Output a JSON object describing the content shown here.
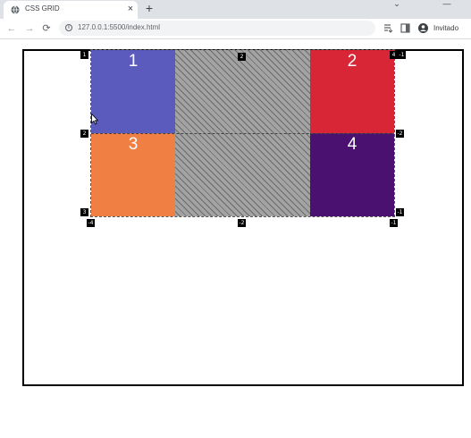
{
  "tab": {
    "title": "CSS GRID",
    "favicon": "globe-icon",
    "close_glyph": "×"
  },
  "tabstrip": {
    "new_tab_glyph": "+",
    "minimize_glyph": "—",
    "chevron_glyph": "⌄"
  },
  "toolbar": {
    "back_glyph": "←",
    "forward_glyph": "→",
    "reload_glyph": "⟳",
    "url": "127.0.0.1:5500/index.html",
    "info_glyph": "i",
    "profile_label": "Invitado"
  },
  "grid": {
    "items": [
      {
        "label": "1",
        "color": "#5b5bbe"
      },
      {
        "label": "2",
        "color": "#d92637"
      },
      {
        "label": "3",
        "color": "#f07f44"
      },
      {
        "label": "4",
        "color": "#4a1170"
      }
    ],
    "gap_fill_color": "#a3a3a3",
    "line_numbers": {
      "top_col_1": "1",
      "top_col_2": "2",
      "top_col_4": "4",
      "top_col_neg1": "-1",
      "left_row_2": "2",
      "right_row_neg2": "-2",
      "bottom_left_row_3": "3",
      "bottom_right_row_neg1": "-1",
      "bottom_col_neg4": "-4",
      "bottom_col_neg2": "-2",
      "bottom_col_neg1": "-1"
    }
  },
  "colors": {
    "tabstrip_bg": "#dee1e6",
    "omnibox_bg": "#f1f3f4",
    "container_border": "#000000"
  }
}
